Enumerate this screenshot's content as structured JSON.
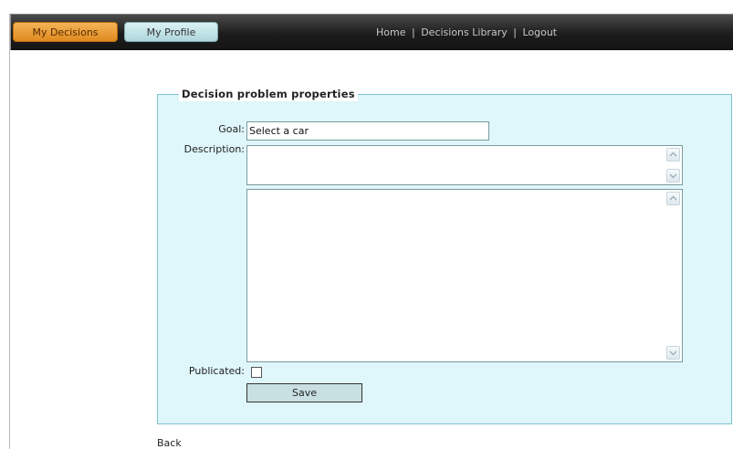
{
  "header": {
    "tabs": [
      {
        "label": "My Decisions",
        "active": true
      },
      {
        "label": "My Profile",
        "active": false
      }
    ],
    "nav": {
      "home": "Home",
      "library": "Decisions Library",
      "logout": "Logout",
      "separator": "|"
    }
  },
  "form": {
    "legend": "Decision problem properties",
    "goal_label": "Goal:",
    "goal_value": "Select a car",
    "description_label": "Description:",
    "description_value": "",
    "details_value": "",
    "published_label": "Publicated:",
    "published_checked": false,
    "save_label": "Save"
  },
  "footer": {
    "back_label": "Back"
  },
  "colors": {
    "active_tab": "#e08a1e",
    "inactive_tab": "#aed6dc",
    "panel_bg": "#dff6fa",
    "panel_border": "#7fc2cc",
    "topbar": "#1c1c1c"
  }
}
